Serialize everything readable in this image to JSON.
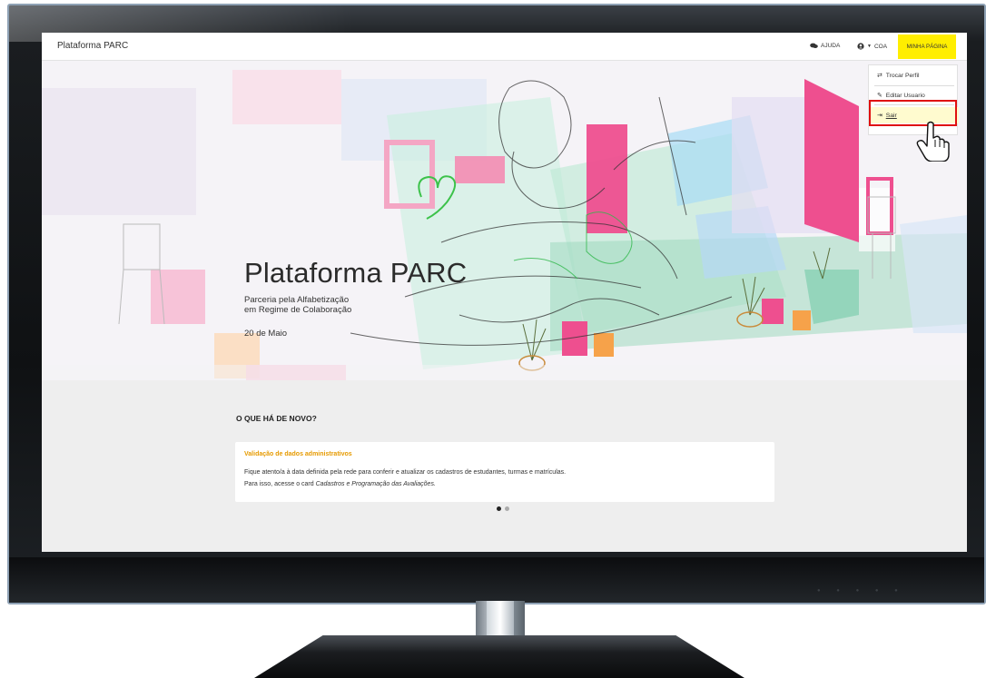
{
  "header": {
    "brand": "Plataforma PARC",
    "help_label": "AJUDA",
    "user_label": "COA",
    "my_page_label": "MINHA PÁGINA"
  },
  "user_menu": {
    "items": [
      {
        "label": "Trocar Perfil",
        "icon": "swap-icon"
      },
      {
        "label": "Editar Usuario",
        "icon": "edit-icon"
      },
      {
        "label": "Sair",
        "icon": "sign-out-icon"
      }
    ]
  },
  "hero": {
    "title": "Plataforma PARC",
    "subtitle_line1": "Parceria pela Alfabetização",
    "subtitle_line2": "em Regime de Colaboração",
    "date": "20 de Maio"
  },
  "news": {
    "section_title": "O QUE HÁ DE NOVO?",
    "card": {
      "heading": "Validação de dados administrativos",
      "line1": "Fique atento/a à data definida pela rede para conferir e atualizar os cadastros de estudantes, turmas e matrículas.",
      "line2_prefix": "Para isso, acesse o card ",
      "line2_emphasis": "Cadastros e Programação das Avaliações."
    },
    "carousel": {
      "total": 2,
      "active_index": 0
    }
  },
  "colors": {
    "accent_yellow": "#ffee00",
    "news_heading": "#e69a00",
    "highlight_border": "#e01010"
  }
}
